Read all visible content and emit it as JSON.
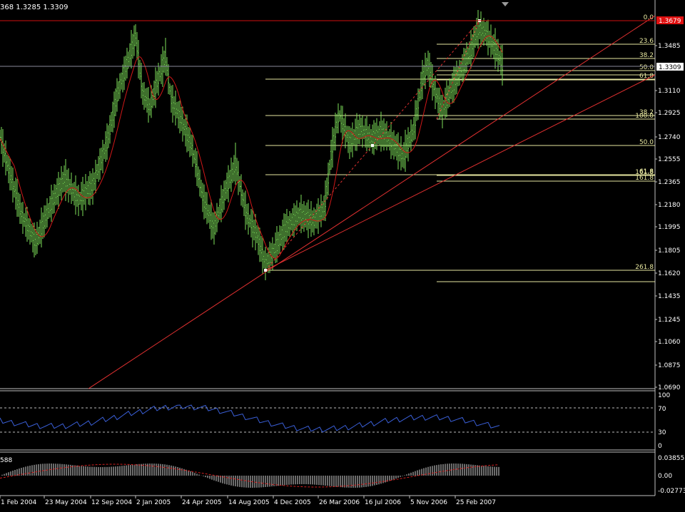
{
  "header": {
    "ohlc_text": "368 1.3285 1.3309",
    "macd_label": "588"
  },
  "colors": {
    "background": "#000000",
    "frame": "#c0c0c0",
    "candle": "#7ee05a",
    "ma": "#d01818",
    "trend": "#e03030",
    "fib": "#e6e6a0",
    "rsi": "#3a5fd8",
    "macd_hist": "#d8d8d8",
    "macd_signal": "#d02020",
    "price_tag_bg": "#e01010"
  },
  "price_axis": {
    "ticks": [
      "1.3485",
      "1.3110",
      "1.2925",
      "1.2740",
      "1.2555",
      "1.2365",
      "1.2180",
      "1.1995",
      "1.1805",
      "1.1620",
      "1.1435",
      "1.1245",
      "1.1060",
      "1.0875",
      "1.0690"
    ],
    "tag_high": "1.3679",
    "tag_current": "1.3309",
    "min": 1.069,
    "max": 1.3679
  },
  "time_axis": {
    "labels": [
      "1 Feb 2004",
      "23 May 2004",
      "12 Sep 2004",
      "2 Jan 2005",
      "24 Apr 2005",
      "14 Aug 2005",
      "4 Dec 2005",
      "26 Mar 2006",
      "16 Jul 2006",
      "5 Nov 2006",
      "25 Feb 2007"
    ]
  },
  "fib_levels": {
    "main": [
      "0.0",
      "23.6",
      "38.2",
      "50.0",
      "61.8",
      "100.0",
      "161.8",
      "261.8"
    ],
    "inner": [
      "23.6",
      "38.2",
      "50.0",
      "61.8",
      "100.0"
    ],
    "secondary": [
      "38.2",
      "50.0",
      "61.8",
      "161.8"
    ]
  },
  "rsi": {
    "axis_labels": [
      "100",
      "70",
      "30",
      "0"
    ],
    "overbought": 70,
    "oversold": 30
  },
  "macd": {
    "axis_labels": [
      "0.03855",
      "0.00",
      "-0.02773"
    ]
  }
}
